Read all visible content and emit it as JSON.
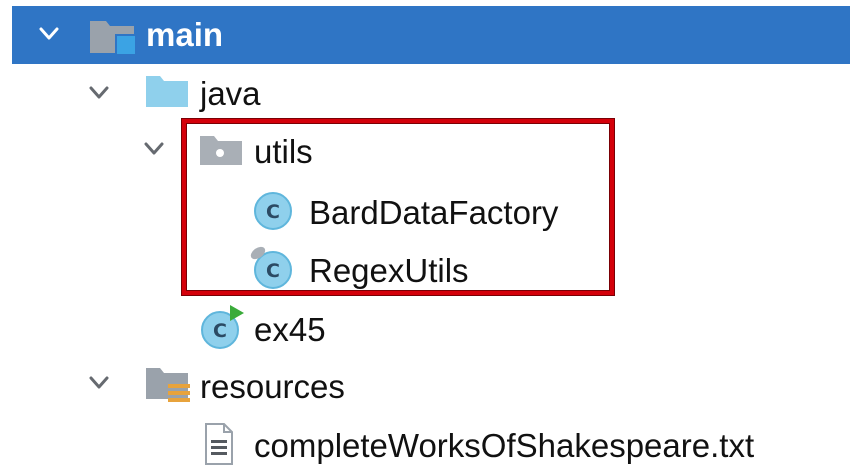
{
  "tree": {
    "main": {
      "label": "main",
      "expanded": true,
      "selected": true,
      "icon": "source-root-folder-icon"
    },
    "java": {
      "label": "java",
      "expanded": true,
      "icon": "source-folder-icon"
    },
    "utils": {
      "label": "utils",
      "expanded": true,
      "icon": "package-icon"
    },
    "bard": {
      "label": "BardDataFactory",
      "icon": "class-icon"
    },
    "regex": {
      "label": "RegexUtils",
      "icon": "class-icon"
    },
    "ex45": {
      "label": "ex45",
      "icon": "runnable-class-icon"
    },
    "resources": {
      "label": "resources",
      "expanded": true,
      "icon": "resources-folder-icon"
    },
    "shakespeare": {
      "label": "completeWorksOfShakespeare.txt",
      "icon": "text-file-icon"
    }
  },
  "colors": {
    "selection": "#2f75c5",
    "highlight_border": "#d4000a",
    "class_icon": "#8fd0ec",
    "folder_blue": "#8fd0ec",
    "folder_gray": "#9aa2ab"
  }
}
